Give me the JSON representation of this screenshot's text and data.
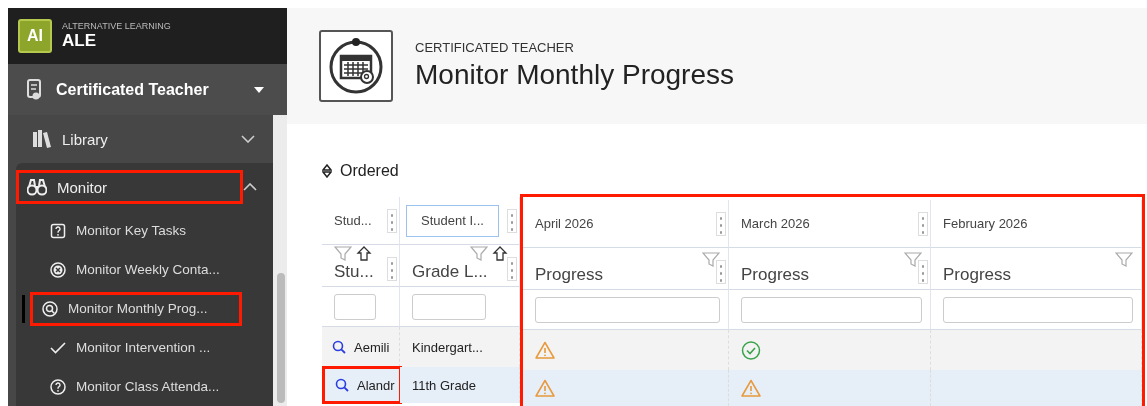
{
  "app": {
    "logo": "AI",
    "subtitle": "ALTERNATIVE LEARNING",
    "title": "ALE"
  },
  "role": {
    "label": "Certificated Teacher"
  },
  "nav": [
    {
      "label": "Library",
      "expanded": false,
      "highlighted": false
    },
    {
      "label": "Monitor",
      "expanded": true,
      "highlighted": true,
      "children": [
        {
          "label": "Monitor Key Tasks",
          "selected": false,
          "highlighted": false
        },
        {
          "label": "Monitor Weekly Conta...",
          "selected": false,
          "highlighted": false
        },
        {
          "label": "Monitor Monthly Prog...",
          "selected": true,
          "highlighted": true
        },
        {
          "label": "Monitor Intervention ...",
          "selected": false,
          "highlighted": false
        },
        {
          "label": "Monitor Class Attenda...",
          "selected": false,
          "highlighted": false
        }
      ]
    }
  ],
  "header": {
    "eyebrow": "CERTIFICATED TEACHER",
    "title": "Monitor Monthly Progress"
  },
  "sort": {
    "label": "Ordered"
  },
  "table": {
    "fixed_columns": [
      {
        "group": "Stud...",
        "label": "Stu...",
        "focused": false
      },
      {
        "group": "Student I...",
        "label": "Grade L...",
        "focused": true
      }
    ],
    "month_columns": [
      {
        "group": "April 2026",
        "label": "Progress"
      },
      {
        "group": "March 2026",
        "label": "Progress"
      },
      {
        "group": "February 2026",
        "label": "Progress"
      }
    ],
    "months_highlighted": true,
    "rows": [
      {
        "selected": false,
        "student": "Aemili",
        "student_highlighted": false,
        "grade": "Kindergart...",
        "progress": [
          {
            "kind": "warning"
          },
          {
            "kind": "done"
          },
          {
            "kind": "none"
          }
        ]
      },
      {
        "selected": true,
        "student": "Alandr",
        "student_highlighted": true,
        "grade": "11th Grade",
        "progress": [
          {
            "kind": "warning"
          },
          {
            "kind": "warning"
          },
          {
            "kind": "none"
          }
        ]
      }
    ]
  }
}
